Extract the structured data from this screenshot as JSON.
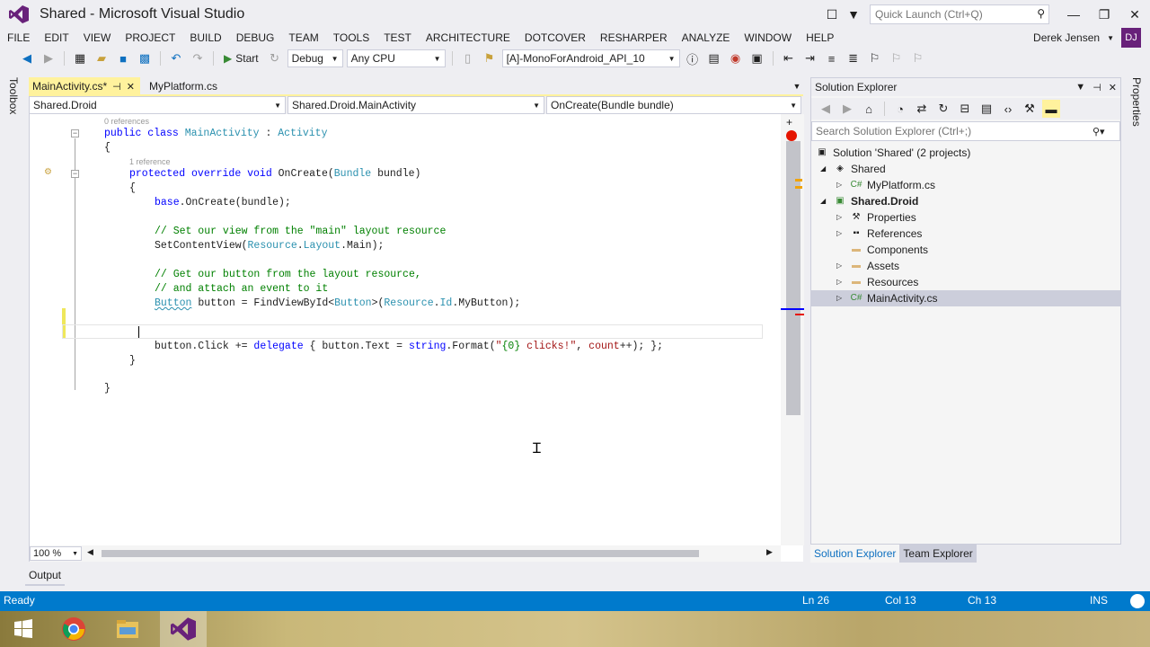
{
  "window": {
    "title": "Shared - Microsoft Visual Studio",
    "quick_launch_placeholder": "Quick Launch (Ctrl+Q)",
    "user_name": "Derek Jensen",
    "user_initials": "DJ"
  },
  "menu": [
    "FILE",
    "EDIT",
    "VIEW",
    "PROJECT",
    "BUILD",
    "DEBUG",
    "TEAM",
    "TOOLS",
    "TEST",
    "ARCHITECTURE",
    "DOTCOVER",
    "RESHARPER",
    "ANALYZE",
    "WINDOW",
    "HELP"
  ],
  "toolbar": {
    "start_label": "Start",
    "config": "Debug",
    "platform": "Any CPU",
    "target": "[A]-MonoForAndroid_API_10"
  },
  "side_tabs": {
    "left": "Toolbox",
    "right": "Properties"
  },
  "editor": {
    "tabs": [
      {
        "label": "MainActivity.cs*",
        "active": true
      },
      {
        "label": "MyPlatform.cs",
        "active": false
      }
    ],
    "nav": {
      "project": "Shared.Droid",
      "type": "Shared.Droid.MainActivity",
      "member": "OnCreate(Bundle bundle)"
    },
    "codelens": {
      "class_refs": "0 references",
      "method_refs": "1 reference"
    },
    "code": {
      "l1_kw": "public class ",
      "l1_name": "MainActivity",
      "l1_sep": " : ",
      "l1_base": "Activity",
      "l2": "{",
      "l3_kw": "protected override void ",
      "l3_name": "OnCreate(",
      "l3_type": "Bundle",
      "l3_rest": " bundle)",
      "l4": "{",
      "l5_kw": "base",
      "l5_rest": ".OnCreate(bundle);",
      "l6_cm": "// Set our view from the \"main\" layout resource",
      "l7_a": "SetContentView(",
      "l7_ty": "Resource",
      "l7_b": ".",
      "l7_ty2": "Layout",
      "l7_c": ".Main);",
      "l8_cm": "// Get our button from the layout resource,",
      "l9_cm": "// and attach an event to it",
      "l10_ty": "Button",
      "l10_a": " button = FindViewById<",
      "l10_ty2": "Button",
      "l10_b": ">(",
      "l10_ty3": "Resource",
      "l10_c": ".",
      "l10_ty4": "Id",
      "l10_d": ".MyButton);",
      "l12_a": "button.Click += ",
      "l12_kw": "delegate",
      "l12_b": " { button.Text = ",
      "l12_kw2": "string",
      "l12_c": ".Format(",
      "l12_st1": "\"",
      "l12_fmt": "{0}",
      "l12_st2": " clicks!\"",
      "l12_d": ", ",
      "l12_cnt": "count",
      "l12_e": "++); };",
      "l13": "}",
      "l14": "}"
    },
    "zoom": "100 %"
  },
  "solution_explorer": {
    "title": "Solution Explorer",
    "search_placeholder": "Search Solution Explorer (Ctrl+;)",
    "tree": [
      {
        "label": "Solution 'Shared' (2 projects)",
        "level": 0
      },
      {
        "label": "Shared",
        "level": 1
      },
      {
        "label": "MyPlatform.cs",
        "level": 2
      },
      {
        "label": "Shared.Droid",
        "level": 1
      },
      {
        "label": "Properties",
        "level": 2
      },
      {
        "label": "References",
        "level": 2
      },
      {
        "label": "Components",
        "level": 2
      },
      {
        "label": "Assets",
        "level": 2
      },
      {
        "label": "Resources",
        "level": 2
      },
      {
        "label": "MainActivity.cs",
        "level": 2
      }
    ],
    "bottom_tabs": [
      "Solution Explorer",
      "Team Explorer"
    ]
  },
  "output_tab": "Output",
  "status": {
    "text": "Ready",
    "ln": "Ln 26",
    "col": "Col 13",
    "ch": "Ch 13",
    "mode": "INS"
  },
  "colors": {
    "accent": "#007acc",
    "tab_active": "#fff29d",
    "vs_purple": "#68217a"
  }
}
